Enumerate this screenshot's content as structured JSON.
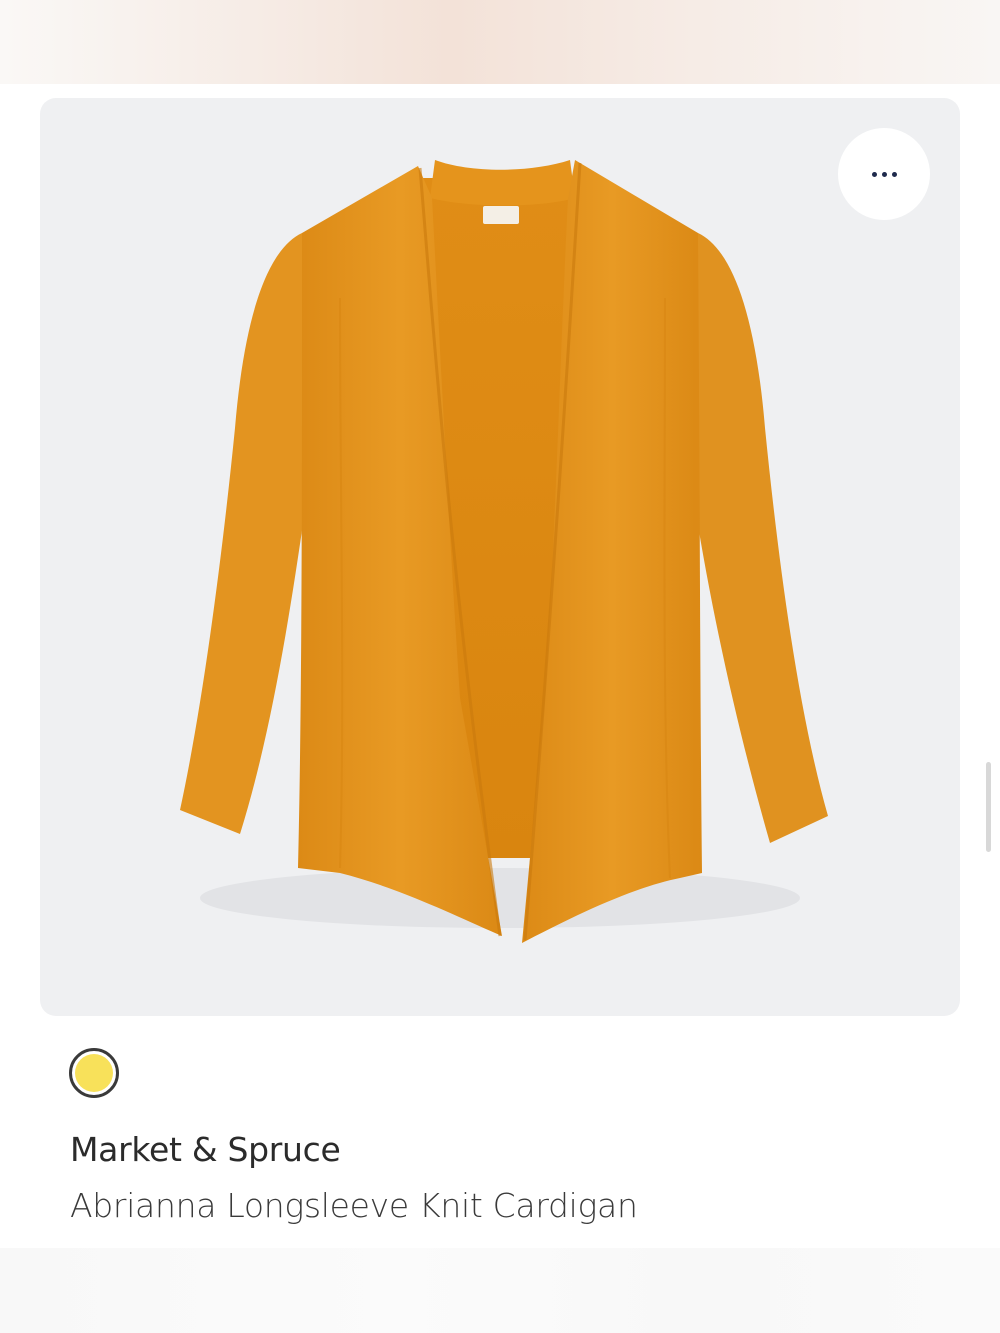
{
  "product": {
    "brand": "Market & Spruce",
    "name": "Abrianna Longsleeve Knit Cardigan",
    "image_alt": "Mustard longsleeve open-front knit cardigan",
    "garment_color": "#e5951f",
    "swatch_color": "#f8e15a"
  },
  "actions": {
    "more_icon": "more-horizontal-icon"
  }
}
